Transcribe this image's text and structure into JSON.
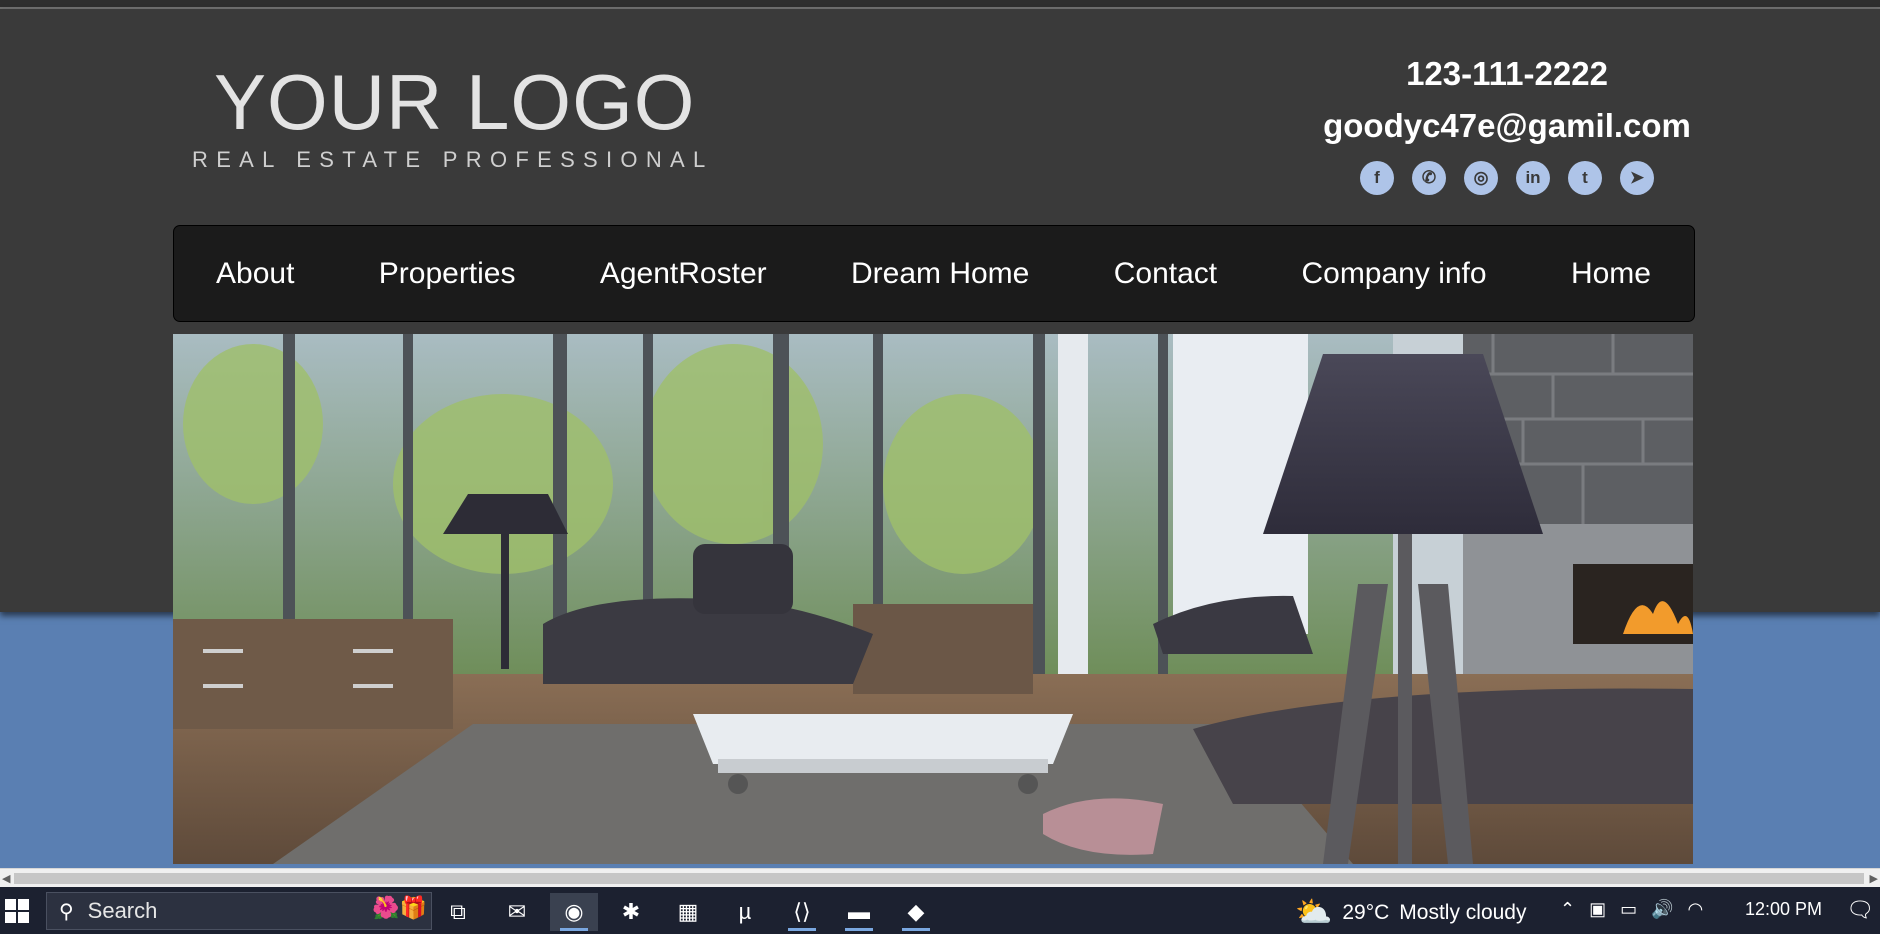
{
  "logo": {
    "main": "YOUR LOGO",
    "sub": "REAL ESTATE PROFESSIONAL"
  },
  "contact": {
    "phone": "123-111-2222",
    "email": "goodyc47e@gamil.com",
    "socials": [
      {
        "name": "facebook-icon",
        "glyph": "f"
      },
      {
        "name": "whatsapp-icon",
        "glyph": "✆"
      },
      {
        "name": "instagram-icon",
        "glyph": "◎"
      },
      {
        "name": "linkedin-icon",
        "glyph": "in"
      },
      {
        "name": "twitter-icon",
        "glyph": "t"
      },
      {
        "name": "telegram-icon",
        "glyph": "➤"
      }
    ]
  },
  "nav": {
    "items": [
      "About",
      "Properties",
      "AgentRoster",
      "Dream Home",
      "Contact",
      "Company info",
      "Home"
    ]
  },
  "colors": {
    "header_bg": "#3a3a3a",
    "nav_bg": "#1b1b1b",
    "page_bg": "#5a7fb2",
    "social_icon": "#aec4e8"
  },
  "scrollbar": {
    "left_arrow": "◀",
    "right_arrow": "▶"
  },
  "taskbar": {
    "search_placeholder": "Search",
    "weather": {
      "temp": "29°C",
      "condition": "Mostly cloudy",
      "icon": "partly-cloudy-icon"
    },
    "clock": "12:00 PM",
    "apps": [
      {
        "name": "task-view-icon",
        "glyph": "⧉"
      },
      {
        "name": "mail-icon",
        "glyph": "✉"
      },
      {
        "name": "chrome-icon",
        "glyph": "◉"
      },
      {
        "name": "slack-icon",
        "glyph": "✱"
      },
      {
        "name": "store-icon",
        "glyph": "▦"
      },
      {
        "name": "torrent-icon",
        "glyph": "µ"
      },
      {
        "name": "vscode-icon",
        "glyph": "⟨⟩"
      },
      {
        "name": "file-explorer-icon",
        "glyph": "▬"
      },
      {
        "name": "git-icon",
        "glyph": "◆"
      }
    ]
  }
}
